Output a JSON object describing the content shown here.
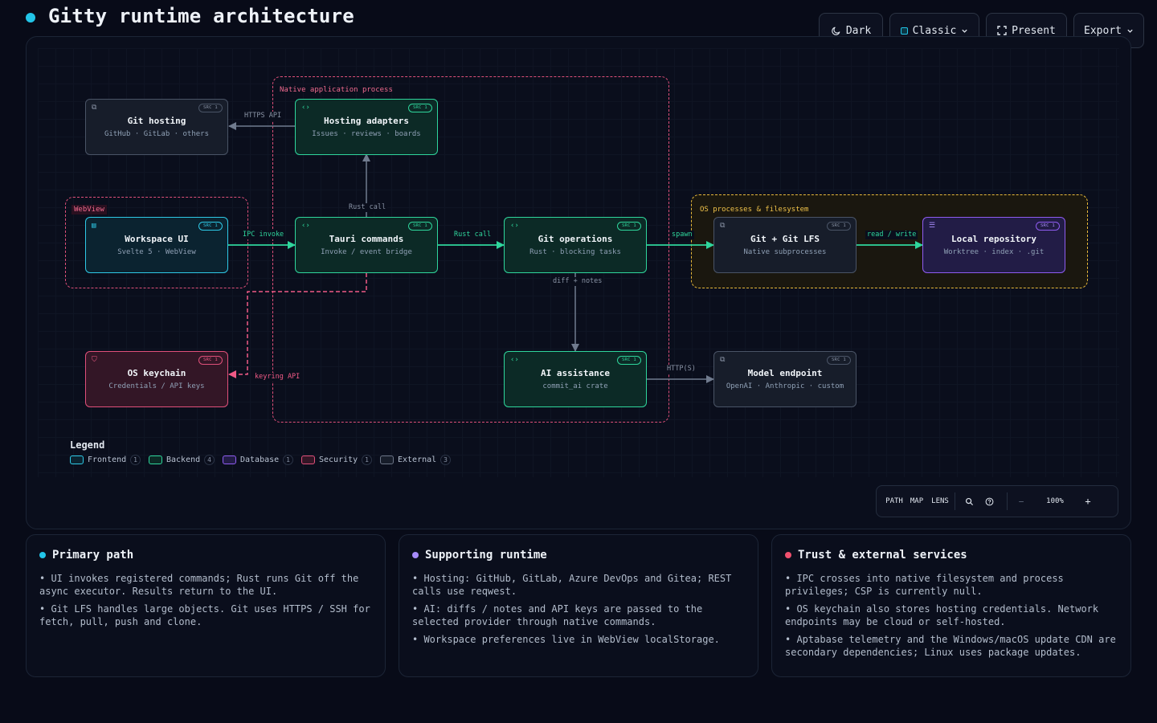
{
  "header": {
    "title": "Gitty runtime architecture",
    "accent": "#22c5e8"
  },
  "toolbar": {
    "theme_label": "Dark",
    "style_label": "Classic",
    "present_label": "Present",
    "export_label": "Export"
  },
  "diagram": {
    "groups": [
      {
        "label": "Native application process",
        "color": "#e0507a",
        "style": "dashed"
      },
      {
        "label": "WebView",
        "color": "#e0507a",
        "style": "dashed"
      },
      {
        "label": "OS processes & filesystem",
        "color": "#e8b93a",
        "style": "dashed"
      }
    ],
    "nodes": [
      {
        "id": "git_hosting",
        "title": "Git hosting",
        "subtitle": "GitHub · GitLab · others",
        "type": "External",
        "icon": "external-link-icon",
        "badge": "SRC 1"
      },
      {
        "id": "hosting_adapters",
        "title": "Hosting adapters",
        "subtitle": "Issues · reviews · boards",
        "type": "Backend",
        "icon": "code-icon",
        "badge": "SRC 1"
      },
      {
        "id": "workspace_ui",
        "title": "Workspace UI",
        "subtitle": "Svelte 5 · WebView",
        "type": "Frontend",
        "icon": "window-icon",
        "badge": "SRC 1"
      },
      {
        "id": "tauri_commands",
        "title": "Tauri commands",
        "subtitle": "Invoke / event bridge",
        "type": "Backend",
        "icon": "code-icon",
        "badge": "SRC 1"
      },
      {
        "id": "git_operations",
        "title": "Git operations",
        "subtitle": "Rust · blocking tasks",
        "type": "Backend",
        "icon": "code-icon",
        "badge": "SRC 1"
      },
      {
        "id": "git_lfs",
        "title": "Git + Git LFS",
        "subtitle": "Native subprocesses",
        "type": "External",
        "icon": "external-link-icon",
        "badge": "SRC 1"
      },
      {
        "id": "local_repo",
        "title": "Local repository",
        "subtitle": "Worktree · index · .git",
        "type": "Database",
        "icon": "database-icon",
        "badge": "SRC 1"
      },
      {
        "id": "os_keychain",
        "title": "OS keychain",
        "subtitle": "Credentials / API keys",
        "type": "Security",
        "icon": "shield-icon",
        "badge": "SRC 1"
      },
      {
        "id": "ai_assistance",
        "title": "AI assistance",
        "subtitle": "commit_ai crate",
        "type": "Backend",
        "icon": "code-icon",
        "badge": "SRC 1"
      },
      {
        "id": "model_endpoint",
        "title": "Model endpoint",
        "subtitle": "OpenAI · Anthropic · custom",
        "type": "External",
        "icon": "external-link-icon",
        "badge": "SRC 1"
      }
    ],
    "edges": [
      {
        "from": "hosting_adapters",
        "to": "git_hosting",
        "label": "HTTPS API"
      },
      {
        "from": "tauri_commands",
        "to": "hosting_adapters",
        "label": "Rust call"
      },
      {
        "from": "workspace_ui",
        "to": "tauri_commands",
        "label": "IPC invoke"
      },
      {
        "from": "tauri_commands",
        "to": "git_operations",
        "label": "Rust call"
      },
      {
        "from": "git_operations",
        "to": "git_lfs",
        "label": "spawn"
      },
      {
        "from": "git_lfs",
        "to": "local_repo",
        "label": "read / write"
      },
      {
        "from": "git_operations",
        "to": "ai_assistance",
        "label": "diff + notes"
      },
      {
        "from": "ai_assistance",
        "to": "model_endpoint",
        "label": "HTTP(S)"
      },
      {
        "from": "tauri_commands",
        "to": "os_keychain",
        "label": "keyring API"
      }
    ]
  },
  "legend": {
    "title": "Legend",
    "items": [
      {
        "label": "Frontend",
        "count": "1",
        "color": "#2ec9e6"
      },
      {
        "label": "Backend",
        "count": "4",
        "color": "#2fd69c"
      },
      {
        "label": "Database",
        "count": "1",
        "color": "#8f5cf0"
      },
      {
        "label": "Security",
        "count": "1",
        "color": "#e0507a"
      },
      {
        "label": "External",
        "count": "3",
        "color": "#6b7486"
      }
    ]
  },
  "zoom_controls": {
    "path_label": "PATH",
    "map_label": "MAP",
    "lens_label": "LENS",
    "zoom_out_label": "−",
    "zoom_level": "100%",
    "zoom_in_label": "+"
  },
  "panels": [
    {
      "title": "Primary path",
      "dot_color": "#22c5e8",
      "items": [
        "• UI invokes registered commands; Rust runs Git off the async executor. Results return to the UI.",
        "• Git LFS handles large objects. Git uses HTTPS / SSH for fetch, pull, push and clone."
      ]
    },
    {
      "title": "Supporting runtime",
      "dot_color": "#a78bfa",
      "items": [
        "• Hosting: GitHub, GitLab, Azure DevOps and Gitea; REST calls use reqwest.",
        "• AI: diffs / notes and API keys are passed to the selected provider through native commands.",
        "• Workspace preferences live in WebView localStorage."
      ]
    },
    {
      "title": "Trust & external services",
      "dot_color": "#f0506e",
      "items": [
        "• IPC crosses into native filesystem and process privileges; CSP is currently null.",
        "• OS keychain also stores hosting credentials. Network endpoints may be cloud or self-hosted.",
        "• Aptabase telemetry and the Windows/macOS update CDN are secondary dependencies; Linux uses package updates."
      ]
    }
  ]
}
